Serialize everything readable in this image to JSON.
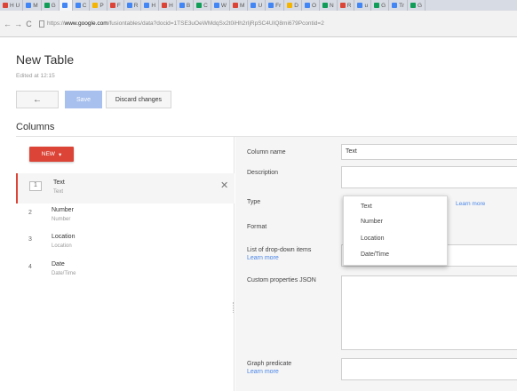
{
  "browser": {
    "tabs": [
      {
        "label": "H U",
        "color": "#db4437",
        "active": false
      },
      {
        "label": "M",
        "color": "#4285f4",
        "active": false
      },
      {
        "label": "G",
        "color": "#0f9d58",
        "active": false
      },
      {
        "label": "",
        "color": "#4285f4",
        "active": true
      },
      {
        "label": "C",
        "color": "#4285f4",
        "active": false
      },
      {
        "label": "P",
        "color": "#f4b400",
        "active": false
      },
      {
        "label": "F",
        "color": "#db4437",
        "active": false
      },
      {
        "label": "R",
        "color": "#4285f4",
        "active": false
      },
      {
        "label": "H",
        "color": "#4285f4",
        "active": false
      },
      {
        "label": "H",
        "color": "#db4437",
        "active": false
      },
      {
        "label": "B",
        "color": "#4285f4",
        "active": false
      },
      {
        "label": "C",
        "color": "#0f9d58",
        "active": false
      },
      {
        "label": "W",
        "color": "#4285f4",
        "active": false
      },
      {
        "label": "M",
        "color": "#db4437",
        "active": false
      },
      {
        "label": "U",
        "color": "#4285f4",
        "active": false
      },
      {
        "label": "Fr",
        "color": "#4285f4",
        "active": false
      },
      {
        "label": "D",
        "color": "#f4b400",
        "active": false
      },
      {
        "label": "O",
        "color": "#4285f4",
        "active": false
      },
      {
        "label": "N",
        "color": "#0f9d58",
        "active": false
      },
      {
        "label": "R",
        "color": "#db4437",
        "active": false
      },
      {
        "label": "u",
        "color": "#4285f4",
        "active": false
      },
      {
        "label": "G",
        "color": "#0f9d58",
        "active": false
      },
      {
        "label": "Tr",
        "color": "#4285f4",
        "active": false
      },
      {
        "label": "G",
        "color": "#0f9d58",
        "active": false
      }
    ],
    "url_prefix": "https://",
    "url_host": "www.google.com",
    "url_rest": "/fusiontables/data?docid=1TSE3uOeWMdqSx2t0iHh2rIjRpSC4UIQ8mi679Pcontid=2"
  },
  "page": {
    "title": "New Table",
    "saved_status": "Edited at 12:15",
    "back_label": "←",
    "save_label": "Save",
    "discard_label": "Discard changes",
    "section_title": "Columns",
    "new_label": "NEW",
    "new_caret": "▾"
  },
  "columns": [
    {
      "num": "1",
      "name": "Text",
      "type": "Text",
      "selected": true
    },
    {
      "num": "2",
      "name": "Number",
      "type": "Number",
      "selected": false
    },
    {
      "num": "3",
      "name": "Location",
      "type": "Location",
      "selected": false
    },
    {
      "num": "4",
      "name": "Date",
      "type": "Date/Time",
      "selected": false
    }
  ],
  "close_glyph": "✕",
  "form": {
    "column_name_label": "Column name",
    "column_name_value": "Text",
    "description_label": "Description",
    "description_value": "",
    "type_label": "Type",
    "type_learn_more": "Learn more",
    "format_label": "Format",
    "dropdown_items_label": "List of drop-down items",
    "dropdown_items_link": "Learn more",
    "custom_props_label": "Custom properties JSON",
    "graph_predicate_label": "Graph predicate",
    "graph_predicate_link": "Learn more"
  },
  "type_options": [
    "Text",
    "Number",
    "Location",
    "Date/Time"
  ],
  "colors": {
    "accent_red": "#db4437",
    "save_blue": "#a7c0ee",
    "link_blue": "#4a86e8"
  }
}
